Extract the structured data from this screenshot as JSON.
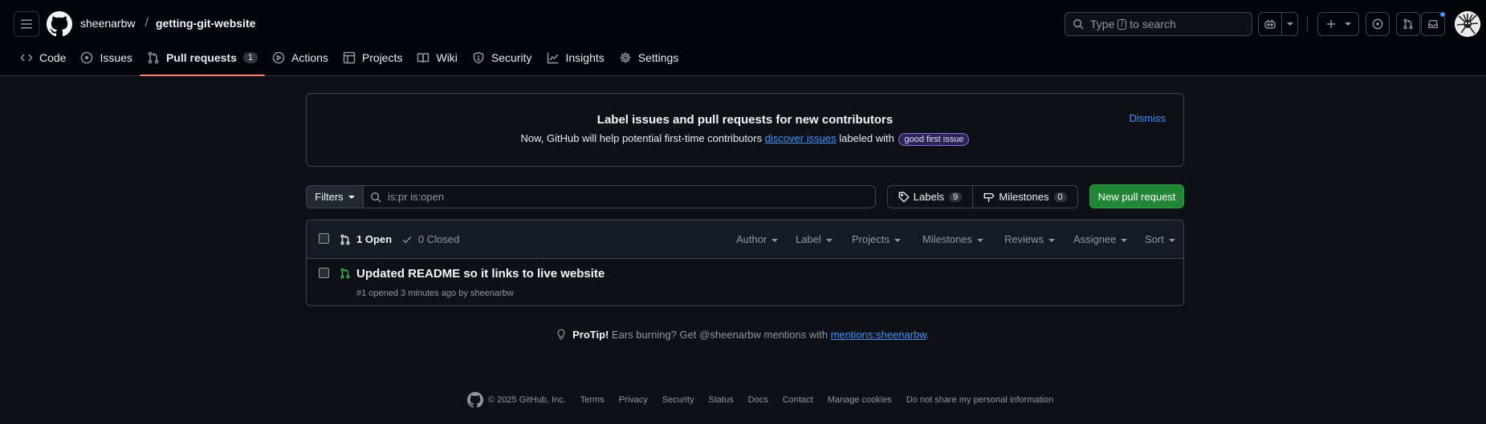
{
  "header": {
    "owner": "sheenarbw",
    "separator": "/",
    "repo": "getting-git-website",
    "search": {
      "prefix": "Type",
      "key": "/",
      "suffix": "to search"
    }
  },
  "tabs": [
    {
      "id": "code",
      "label": "Code",
      "icon": "code-icon"
    },
    {
      "id": "issues",
      "label": "Issues",
      "icon": "issue-opened-icon"
    },
    {
      "id": "pull-requests",
      "label": "Pull requests",
      "icon": "git-pull-request-icon",
      "counter": "1",
      "active": true
    },
    {
      "id": "actions",
      "label": "Actions",
      "icon": "play-icon"
    },
    {
      "id": "projects",
      "label": "Projects",
      "icon": "table-icon"
    },
    {
      "id": "wiki",
      "label": "Wiki",
      "icon": "book-icon"
    },
    {
      "id": "security",
      "label": "Security",
      "icon": "shield-icon"
    },
    {
      "id": "insights",
      "label": "Insights",
      "icon": "graph-icon"
    },
    {
      "id": "settings",
      "label": "Settings",
      "icon": "gear-icon"
    }
  ],
  "banner": {
    "title": "Label issues and pull requests for new contributors",
    "text_before": "Now, GitHub will help potential first-time contributors",
    "link": "discover issues",
    "text_after": "labeled with",
    "label": "good first issue",
    "dismiss": "Dismiss"
  },
  "toolbar": {
    "filters": "Filters",
    "query": "is:pr is:open",
    "labels": "Labels",
    "labels_count": "9",
    "milestones": "Milestones",
    "milestones_count": "0",
    "new_pr": "New pull request"
  },
  "list": {
    "open": "1 Open",
    "closed": "0 Closed",
    "sorts": [
      "Author",
      "Label",
      "Projects",
      "Milestones",
      "Reviews",
      "Assignee",
      "Sort"
    ],
    "items": [
      {
        "title": "Updated README so it links to live website",
        "meta": "#1 opened 3 minutes ago by sheenarbw"
      }
    ]
  },
  "protip": {
    "lead": "ProTip!",
    "text": "Ears burning? Get @sheenarbw mentions with",
    "link": "mentions:sheenarbw",
    "end": "."
  },
  "footer": {
    "copyright": "© 2025 GitHub, Inc.",
    "links": [
      "Terms",
      "Privacy",
      "Security",
      "Status",
      "Docs",
      "Contact",
      "Manage cookies",
      "Do not share my personal information"
    ]
  },
  "colors": {
    "accent": "#4493f8",
    "open_green": "#3fb950",
    "button_green": "#238636",
    "tab_underline": "#f78166"
  }
}
